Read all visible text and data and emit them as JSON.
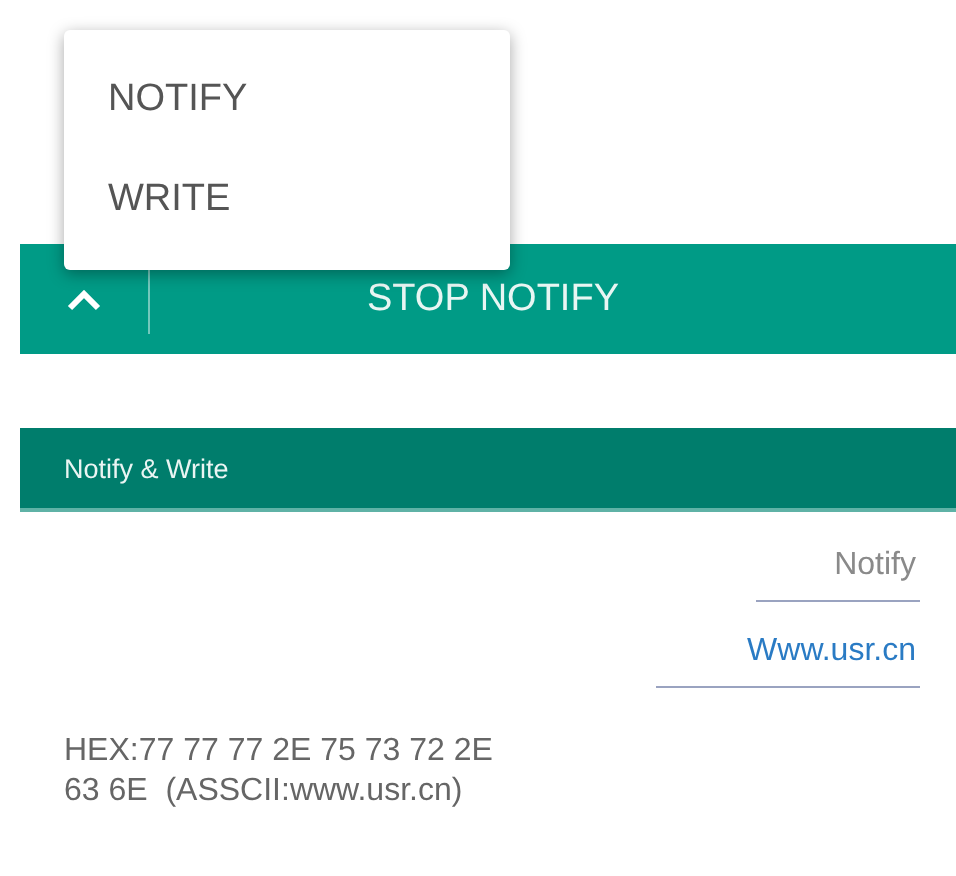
{
  "menu": {
    "items": [
      {
        "label": "NOTIFY"
      },
      {
        "label": "WRITE"
      }
    ]
  },
  "action_bar": {
    "button": "STOP NOTIFY"
  },
  "section": {
    "title": "Notify & Write"
  },
  "fields": [
    {
      "placeholder": "Notify"
    },
    {
      "value": "Www.usr.cn"
    }
  ],
  "output": {
    "lines": [
      "HEX:77 77 77 2E 75 73 72 2E",
      "63 6E  (ASSCII:www.usr.cn)"
    ]
  }
}
